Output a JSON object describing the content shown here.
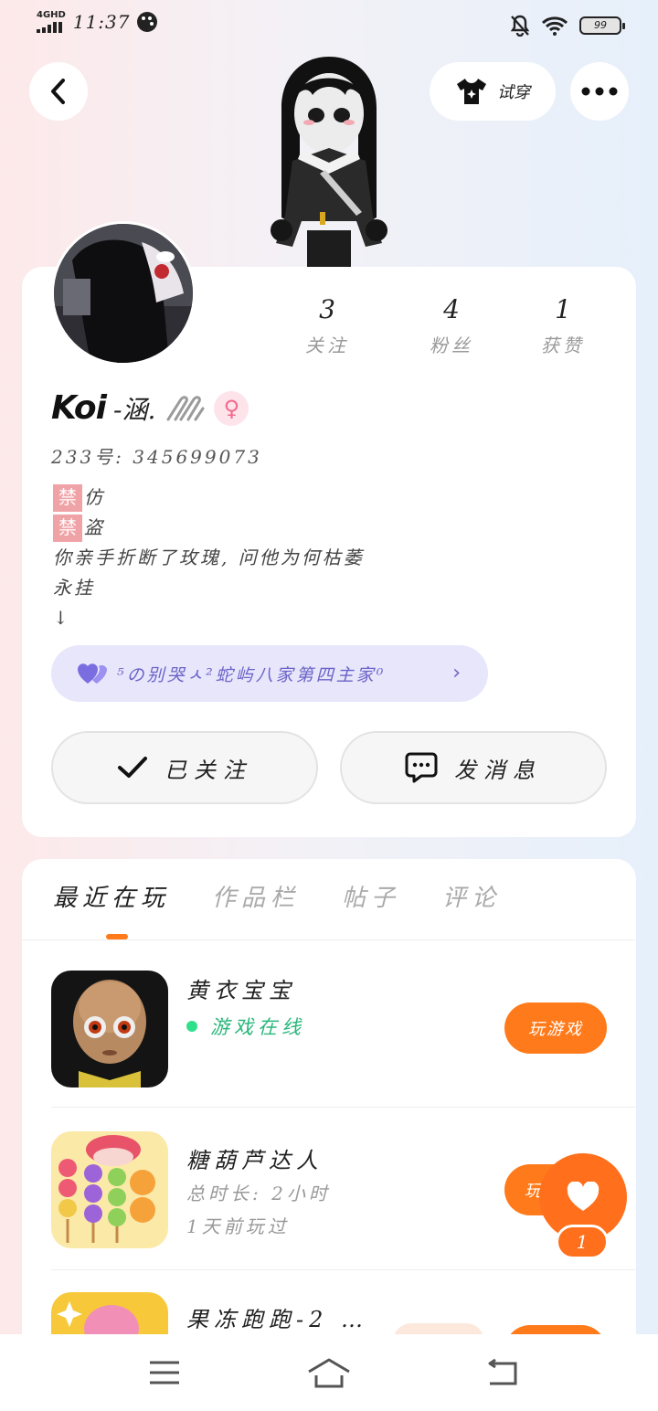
{
  "status_bar": {
    "network": "4GHD",
    "time": "11:37",
    "battery": "99"
  },
  "header": {
    "tryon_label": "试穿"
  },
  "profile": {
    "stats": [
      {
        "value": "3",
        "label": "关注"
      },
      {
        "value": "4",
        "label": "粉丝"
      },
      {
        "value": "1",
        "label": "获赞"
      }
    ],
    "name": "Koi",
    "name_suffix": "-涵.",
    "uid": "233号: 345699073",
    "bio": {
      "ban_char": "禁",
      "line1": "仿",
      "line2": "盗",
      "line3": "你亲手折断了玫瑰, 问他为何枯萎",
      "line4": "永挂",
      "line5": "↓"
    },
    "family_tag": "⁵の别哭ㅅ²蛇屿八家第四主家⁰",
    "follow_label": "已关注",
    "message_label": "发消息"
  },
  "tabs": [
    {
      "label": "最近在玩",
      "active": true
    },
    {
      "label": "作品栏",
      "active": false
    },
    {
      "label": "帖子",
      "active": false
    },
    {
      "label": "评论",
      "active": false
    }
  ],
  "games": [
    {
      "title": "黄衣宝宝",
      "status": "游戏在线",
      "button": "玩游戏"
    },
    {
      "title": "糖葫芦达人",
      "meta1": "总时长: 2小时",
      "meta2": "1天前玩过",
      "button": "玩"
    },
    {
      "title": "果冻跑跑-2 …"
    }
  ],
  "float_like": {
    "count": "1"
  },
  "colors": {
    "accent": "#ff7a1a",
    "family_bg": "#e7e6fb",
    "online": "#2ee08a"
  }
}
